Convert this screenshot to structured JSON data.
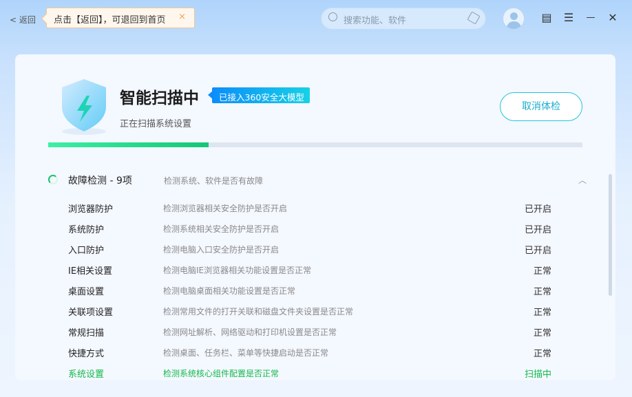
{
  "topbar": {
    "back_label": "< 返回",
    "tip_text": "点击【返回】，可退回到首页",
    "tip_close": "×",
    "search_placeholder": "搜索功能、软件"
  },
  "window_buttons": {
    "skin": "▤",
    "menu": "☰",
    "minimize": "—",
    "close": "✕"
  },
  "scan": {
    "title": "智能扫描中",
    "badge": "已接入360安全大模型",
    "subtitle": "正在扫描系统设置",
    "cancel_label": "取消体检",
    "progress_percent": 30
  },
  "group": {
    "name": "故障检测 - 9项",
    "desc": "检测系统、软件是否有故障",
    "chevron": "︿"
  },
  "items": [
    {
      "name": "浏览器防护",
      "desc": "检测浏览器相关安全防护是否开启",
      "status": "已开启"
    },
    {
      "name": "系统防护",
      "desc": "检测系统相关安全防护是否开启",
      "status": "已开启"
    },
    {
      "name": "入口防护",
      "desc": "检测电脑入口安全防护是否开启",
      "status": "已开启"
    },
    {
      "name": "IE相关设置",
      "desc": "检测电脑IE浏览器相关功能设置是否正常",
      "status": "正常"
    },
    {
      "name": "桌面设置",
      "desc": "检测电脑桌面相关功能设置是否正常",
      "status": "正常"
    },
    {
      "name": "关联项设置",
      "desc": "检测常用文件的打开关联和磁盘文件夹设置是否正常",
      "status": "正常"
    },
    {
      "name": "常规扫描",
      "desc": "检测网址解析、网络驱动和打印机设置是否正常",
      "status": "正常"
    },
    {
      "name": "快捷方式",
      "desc": "检测桌面、任务栏、菜单等快捷启动是否正常",
      "status": "正常"
    },
    {
      "name": "系统设置",
      "desc": "检测系统核心组件配置是否正常",
      "status": "扫描中"
    }
  ]
}
